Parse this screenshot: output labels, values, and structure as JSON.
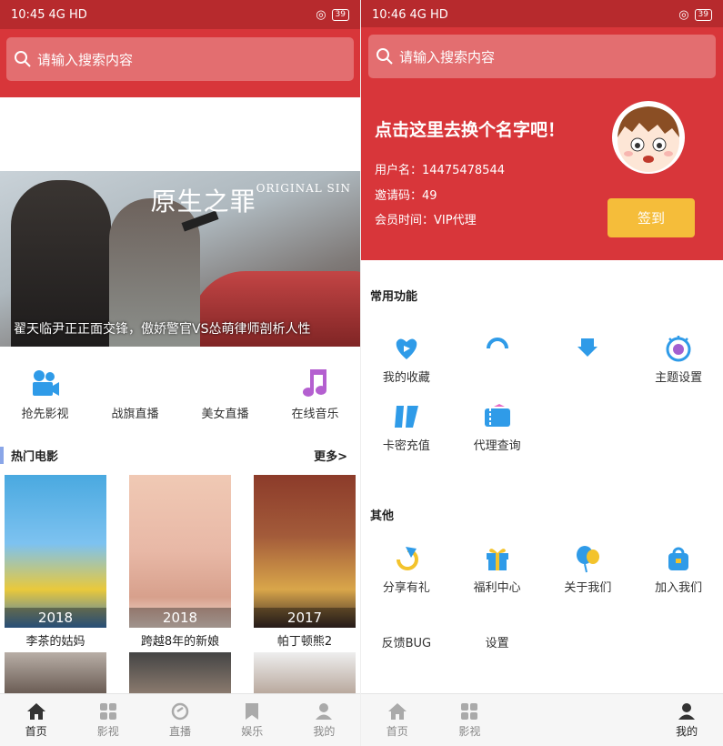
{
  "left": {
    "status": {
      "time": "10:45",
      "signal": "4G HD",
      "battery": "39"
    },
    "search": {
      "placeholder": "请输入搜索内容"
    },
    "banner": {
      "title": "原生之罪",
      "title_en": "ORIGINAL SIN",
      "caption": "翟天临尹正正面交锋，傲娇警官VS怂萌律师剖析人性"
    },
    "quick": [
      {
        "label": "抢先影视",
        "icon": "video-camera-icon",
        "color": "#2f9be8"
      },
      {
        "label": "战旗直播",
        "icon": "",
        "color": ""
      },
      {
        "label": "美女直播",
        "icon": "",
        "color": ""
      },
      {
        "label": "在线音乐",
        "icon": "music-note-icon",
        "color": "#b45fd0"
      }
    ],
    "section": {
      "title": "热门电影",
      "more": "更多>"
    },
    "movies": [
      {
        "title": "李茶的姑妈",
        "year": "2018"
      },
      {
        "title": "跨越8年的新娘",
        "year": "2018"
      },
      {
        "title": "帕丁顿熊2",
        "year": "2017"
      }
    ],
    "tabs": [
      {
        "label": "首页",
        "icon": "home-icon"
      },
      {
        "label": "影视",
        "icon": "grid-icon"
      },
      {
        "label": "直播",
        "icon": "live-icon"
      },
      {
        "label": "娱乐",
        "icon": "bookmark-icon"
      },
      {
        "label": "我的",
        "icon": "user-icon"
      }
    ]
  },
  "right": {
    "status": {
      "time": "10:46",
      "signal": "4G HD",
      "battery": "39"
    },
    "search": {
      "placeholder": "请输入搜索内容"
    },
    "profile": {
      "name": "点击这里去换个名字吧！",
      "username": "用户名：14475478544",
      "invite": "邀请码：49",
      "vip": "会员时间：VIP代理",
      "signin": "签到"
    },
    "common": {
      "title": "常用功能",
      "items": [
        {
          "label": "我的收藏",
          "icon": "heart-icon"
        },
        {
          "label": "",
          "icon": "refresh-icon"
        },
        {
          "label": "",
          "icon": "download-icon"
        },
        {
          "label": "主题设置",
          "icon": "eye-icon"
        },
        {
          "label": "卡密充值",
          "icon": "card-icon"
        },
        {
          "label": "代理查询",
          "icon": "ticket-icon"
        }
      ]
    },
    "other": {
      "title": "其他",
      "items": [
        {
          "label": "分享有礼",
          "icon": "share-icon"
        },
        {
          "label": "福利中心",
          "icon": "gift-icon"
        },
        {
          "label": "关于我们",
          "icon": "balloon-icon"
        },
        {
          "label": "加入我们",
          "icon": "bag-icon"
        },
        {
          "label": "反馈BUG",
          "icon": ""
        },
        {
          "label": "设置",
          "icon": ""
        }
      ]
    },
    "tabs": [
      {
        "label": "首页",
        "icon": "home-icon"
      },
      {
        "label": "影视",
        "icon": "grid-icon"
      },
      {
        "label": "",
        "icon": ""
      },
      {
        "label": "",
        "icon": ""
      },
      {
        "label": "我的",
        "icon": "user-icon"
      }
    ]
  },
  "colors": {
    "primary": "#d8363a",
    "accent_blue": "#2f9be8",
    "signin": "#f5bd3a"
  }
}
